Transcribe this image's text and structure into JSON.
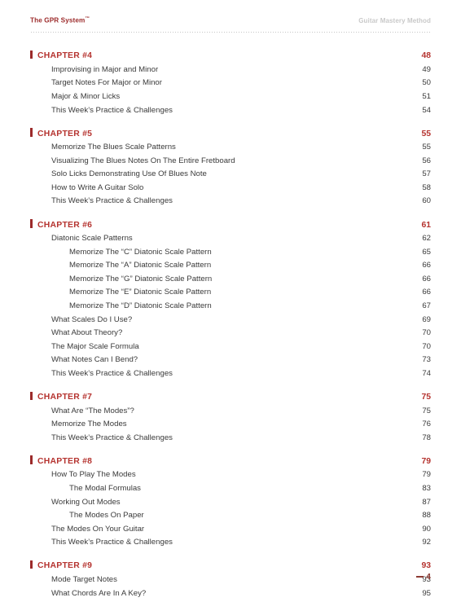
{
  "header": {
    "left_title": "The GPR System",
    "left_trademark": "™",
    "right_title": "Guitar Mastery Method"
  },
  "footer": {
    "page_number": "4"
  },
  "colors": {
    "chapter_red": "#b5332f",
    "marker_red": "#9c2b2b",
    "header_red": "#9c2b2b",
    "header_gray": "#c9c9c9",
    "body_text": "#3a3a3a",
    "footer_red": "#8d3b33"
  },
  "toc": {
    "chapters": [
      {
        "label": "CHAPTER #4",
        "page": "48",
        "entries": [
          {
            "level": 1,
            "title": "Improvising in Major and Minor",
            "page": "49"
          },
          {
            "level": 1,
            "title": "Target Notes For Major or Minor",
            "page": "50"
          },
          {
            "level": 1,
            "title": "Major & Minor Licks",
            "page": "51"
          },
          {
            "level": 1,
            "title": "This Week’s Practice & Challenges",
            "page": "54"
          }
        ]
      },
      {
        "label": "CHAPTER #5",
        "page": "55",
        "entries": [
          {
            "level": 1,
            "title": "Memorize The Blues Scale Patterns",
            "page": "55"
          },
          {
            "level": 1,
            "title": "Visualizing The Blues Notes On The Entire Fretboard",
            "page": "56"
          },
          {
            "level": 1,
            "title": "Solo Licks Demonstrating Use Of Blues Note",
            "page": "57"
          },
          {
            "level": 1,
            "title": "How to Write A Guitar Solo",
            "page": "58"
          },
          {
            "level": 1,
            "title": "This Week’s Practice & Challenges",
            "page": "60"
          }
        ]
      },
      {
        "label": "CHAPTER #6",
        "page": "61",
        "entries": [
          {
            "level": 1,
            "title": "Diatonic Scale Patterns",
            "page": "62"
          },
          {
            "level": 2,
            "title": "Memorize The “C” Diatonic Scale Pattern",
            "page": "65"
          },
          {
            "level": 2,
            "title": "Memorize The “A” Diatonic Scale Pattern",
            "page": "66"
          },
          {
            "level": 2,
            "title": "Memorize The “G” Diatonic Scale Pattern",
            "page": "66"
          },
          {
            "level": 2,
            "title": "Memorize The “E” Diatonic Scale Pattern",
            "page": "66"
          },
          {
            "level": 2,
            "title": "Memorize The “D” Diatonic Scale Pattern",
            "page": "67"
          },
          {
            "level": 1,
            "title": "What Scales Do I Use?",
            "page": "69"
          },
          {
            "level": 1,
            "title": "What About Theory?",
            "page": "70"
          },
          {
            "level": 1,
            "title": "The Major Scale Formula",
            "page": "70"
          },
          {
            "level": 1,
            "title": "What Notes Can I Bend?",
            "page": "73"
          },
          {
            "level": 1,
            "title": "This Week’s Practice & Challenges",
            "page": "74"
          }
        ]
      },
      {
        "label": "CHAPTER #7",
        "page": "75",
        "entries": [
          {
            "level": 1,
            "title": "What Are “The Modes”?",
            "page": "75"
          },
          {
            "level": 1,
            "title": "Memorize The Modes",
            "page": "76"
          },
          {
            "level": 1,
            "title": "This Week’s Practice & Challenges",
            "page": "78"
          }
        ]
      },
      {
        "label": "CHAPTER #8",
        "page": "79",
        "entries": [
          {
            "level": 1,
            "title": "How To Play The Modes",
            "page": "79"
          },
          {
            "level": 2,
            "title": "The Modal Formulas",
            "page": "83"
          },
          {
            "level": 1,
            "title": "Working Out Modes",
            "page": "87"
          },
          {
            "level": 2,
            "title": "The Modes On Paper",
            "page": "88"
          },
          {
            "level": 1,
            "title": "The Modes On Your Guitar",
            "page": "90"
          },
          {
            "level": 1,
            "title": "This Week’s Practice & Challenges",
            "page": "92"
          }
        ]
      },
      {
        "label": "CHAPTER #9",
        "page": "93",
        "entries": [
          {
            "level": 1,
            "title": "Mode Target Notes",
            "page": "93"
          },
          {
            "level": 1,
            "title": "What Chords Are In A Key?",
            "page": "95"
          }
        ]
      }
    ]
  }
}
